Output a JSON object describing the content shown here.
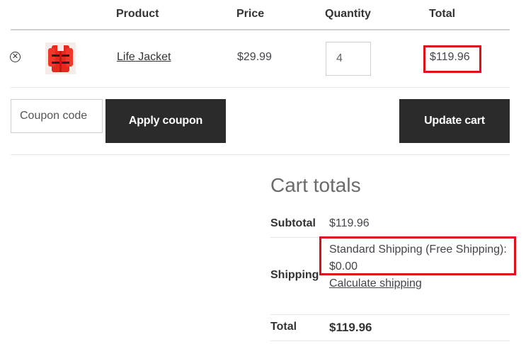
{
  "table": {
    "headers": {
      "product": "Product",
      "price": "Price",
      "quantity": "Quantity",
      "total": "Total"
    },
    "rows": [
      {
        "name": "Life Jacket",
        "price": "$29.99",
        "quantity": "4",
        "total": "$119.96"
      }
    ]
  },
  "actions": {
    "coupon_placeholder": "Coupon code",
    "apply_coupon": "Apply coupon",
    "update_cart": "Update cart"
  },
  "cart_totals": {
    "title": "Cart totals",
    "subtotal_label": "Subtotal",
    "subtotal_value": "$119.96",
    "shipping_label": "Shipping",
    "shipping_line1": "Standard Shipping (Free Shipping):",
    "shipping_line2": "$0.00",
    "calculate_shipping": "Calculate shipping",
    "total_label": "Total",
    "total_value": "$119.96"
  },
  "icons": {
    "remove": "remove-circle-x-icon",
    "thumbnail": "life-jacket-thumbnail"
  },
  "colors": {
    "button_bg": "#2b2b2b",
    "highlight": "#e0101a"
  }
}
